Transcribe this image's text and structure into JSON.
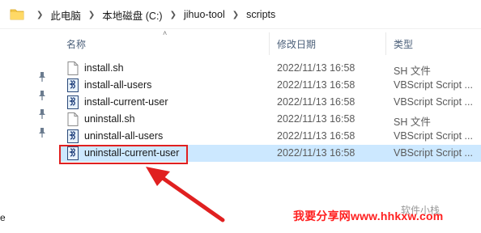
{
  "address_bar": {
    "crumbs": [
      "此电脑",
      "本地磁盘 (C:)",
      "jihuo-tool",
      "scripts"
    ]
  },
  "columns": {
    "name": "名称",
    "date": "修改日期",
    "type": "类型"
  },
  "files": [
    {
      "name": "install.sh",
      "date": "2022/11/13 16:58",
      "type": "SH 文件",
      "icon": "sh-file-icon"
    },
    {
      "name": "install-all-users",
      "date": "2022/11/13 16:58",
      "type": "VBScript Script ...",
      "icon": "vbscript-file-icon"
    },
    {
      "name": "install-current-user",
      "date": "2022/11/13 16:58",
      "type": "VBScript Script ...",
      "icon": "vbscript-file-icon"
    },
    {
      "name": "uninstall.sh",
      "date": "2022/11/13 16:58",
      "type": "SH 文件",
      "icon": "sh-file-icon"
    },
    {
      "name": "uninstall-all-users",
      "date": "2022/11/13 16:58",
      "type": "VBScript Script ...",
      "icon": "vbscript-file-icon"
    },
    {
      "name": "uninstall-current-user",
      "date": "2022/11/13 16:58",
      "type": "VBScript Script ...",
      "icon": "vbscript-file-icon",
      "selected": true
    }
  ],
  "left_pane": {
    "edge_text": "e"
  },
  "watermark": {
    "text": "我要分享网www.hhkxw.com",
    "overlay_text": "软件小栈"
  },
  "colors": {
    "selection": "#cce8ff",
    "highlight_box": "#e02020",
    "arrow": "#e02020",
    "watermark": "#ff2020"
  }
}
